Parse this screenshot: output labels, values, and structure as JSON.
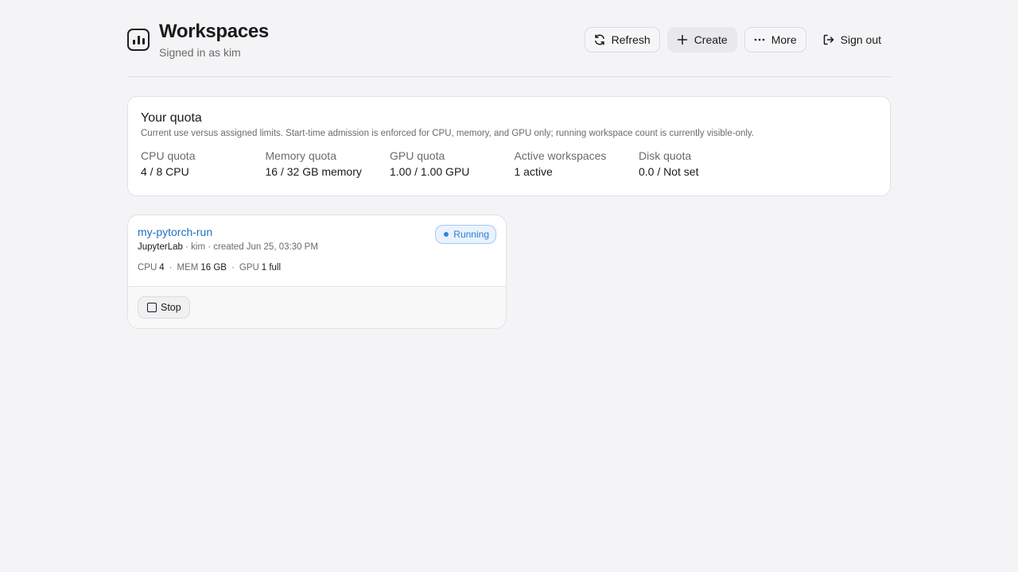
{
  "header": {
    "title": "Workspaces",
    "subtitle": "Signed in as kim",
    "logo_icon": "bar-chart-icon",
    "actions": [
      {
        "label": "Refresh",
        "icon": "refresh-icon"
      },
      {
        "label": "Create",
        "icon": "plus-icon"
      },
      {
        "label": "More",
        "icon": "ellipsis-icon"
      },
      {
        "label": "Sign out",
        "icon": "sign-out-icon"
      }
    ]
  },
  "quota": {
    "title": "Your quota",
    "description": "Current use versus assigned limits. Start-time admission is enforced for CPU, memory, and GPU only; running workspace count is currently visible-only.",
    "items": [
      {
        "label": "CPU quota",
        "value": "4 / 8 CPU"
      },
      {
        "label": "Memory quota",
        "value": "16 / 32 GB memory"
      },
      {
        "label": "GPU quota",
        "value": "1.00 / 1.00 GPU"
      },
      {
        "label": "Active workspaces",
        "value": "1 active"
      },
      {
        "label": "Disk quota",
        "value": "0.0 / Not set"
      }
    ]
  },
  "workspaces": [
    {
      "name": "my-pytorch-run",
      "app": "JupyterLab",
      "meta": "· kim · created Jun 25, 03:30 PM",
      "status": "Running",
      "resources": {
        "cpu_label": "CPU",
        "cpu_value": "4",
        "mem_label": "MEM",
        "mem_value": "16 GB",
        "gpu_label": "GPU",
        "gpu_value": "1 full",
        "separator": "·"
      },
      "stop_label": "Stop"
    }
  ],
  "colors": {
    "background": "#f4f4f6",
    "accent_link": "#1f6fc5",
    "status_running": "#2b7bd0"
  }
}
